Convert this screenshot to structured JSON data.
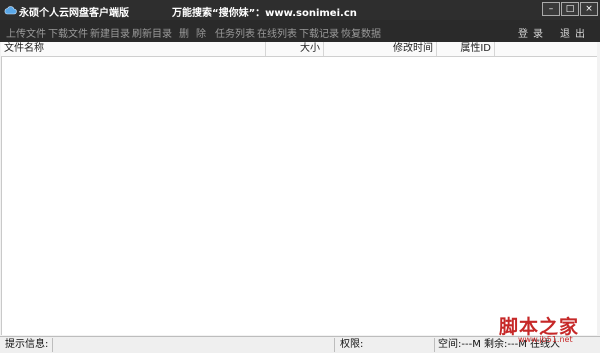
{
  "window": {
    "title": "永硕个人云网盘客户端版",
    "promo": "万能搜索“搜你妹”：www.sonimei.cn",
    "controls": [
      "–",
      "□",
      "×"
    ]
  },
  "toolbar": {
    "items": [
      "上传文件",
      "下载文件",
      "新建目录",
      "刷新目录",
      "删",
      "除",
      "任务列表",
      "在线列表",
      "下载记录",
      "恢复数据"
    ],
    "login": "登录",
    "exit": "退出"
  },
  "table": {
    "columns": [
      "文件名称",
      "大小",
      "修改时间",
      "属性ID"
    ],
    "rows": []
  },
  "status": {
    "info_label": "提示信息:",
    "permission_label": "权限:",
    "space_text": "空间:---M 剩余:---M 在线人"
  },
  "watermark": {
    "logo": "脚本之家",
    "url": "www.jb51.net"
  },
  "colors": {
    "titlebar": "#2e2e2e",
    "toolbar": "#2a2a2a",
    "watermark": "#c62828"
  }
}
